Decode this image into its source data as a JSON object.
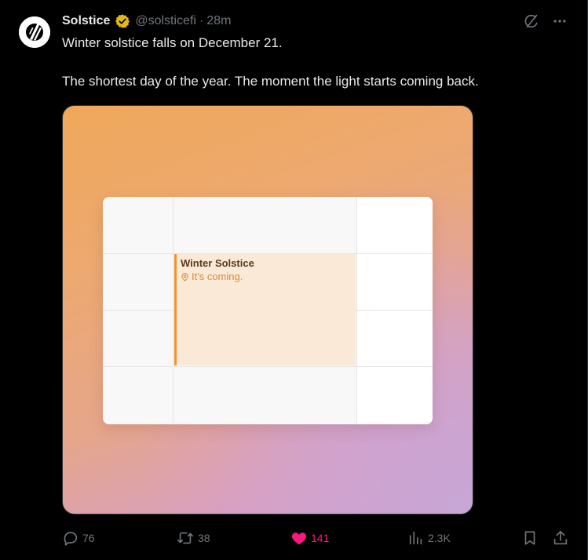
{
  "tweet": {
    "author_name": "Solstice",
    "handle": "@solsticefi",
    "separator": "·",
    "time": "28m",
    "text_paragraphs": [
      "Winter solstice falls on December 21.",
      "The shortest day of the year. The moment the light starts coming back."
    ]
  },
  "media": {
    "event_title": "Winter Solstice",
    "event_subtitle": "It's coming."
  },
  "actions": {
    "replies": "76",
    "reposts": "38",
    "likes": "141",
    "views": "2.3K"
  },
  "icons": {
    "avatar": "solstice-logo",
    "verified": "verified-gold-badge",
    "grok": "grok-icon",
    "more": "more-icon",
    "reply": "reply-icon",
    "repost": "repost-icon",
    "like": "heart-icon",
    "views": "analytics-icon",
    "bookmark": "bookmark-icon",
    "share": "share-icon",
    "location": "location-pin-icon"
  },
  "colors": {
    "background": "#000000",
    "text_primary": "#e7e9ea",
    "text_secondary": "#71767b",
    "like_active": "#f91880",
    "verified_gold": "#e2b719",
    "event_accent": "#f0932f",
    "event_fill": "#fbe9d8"
  }
}
